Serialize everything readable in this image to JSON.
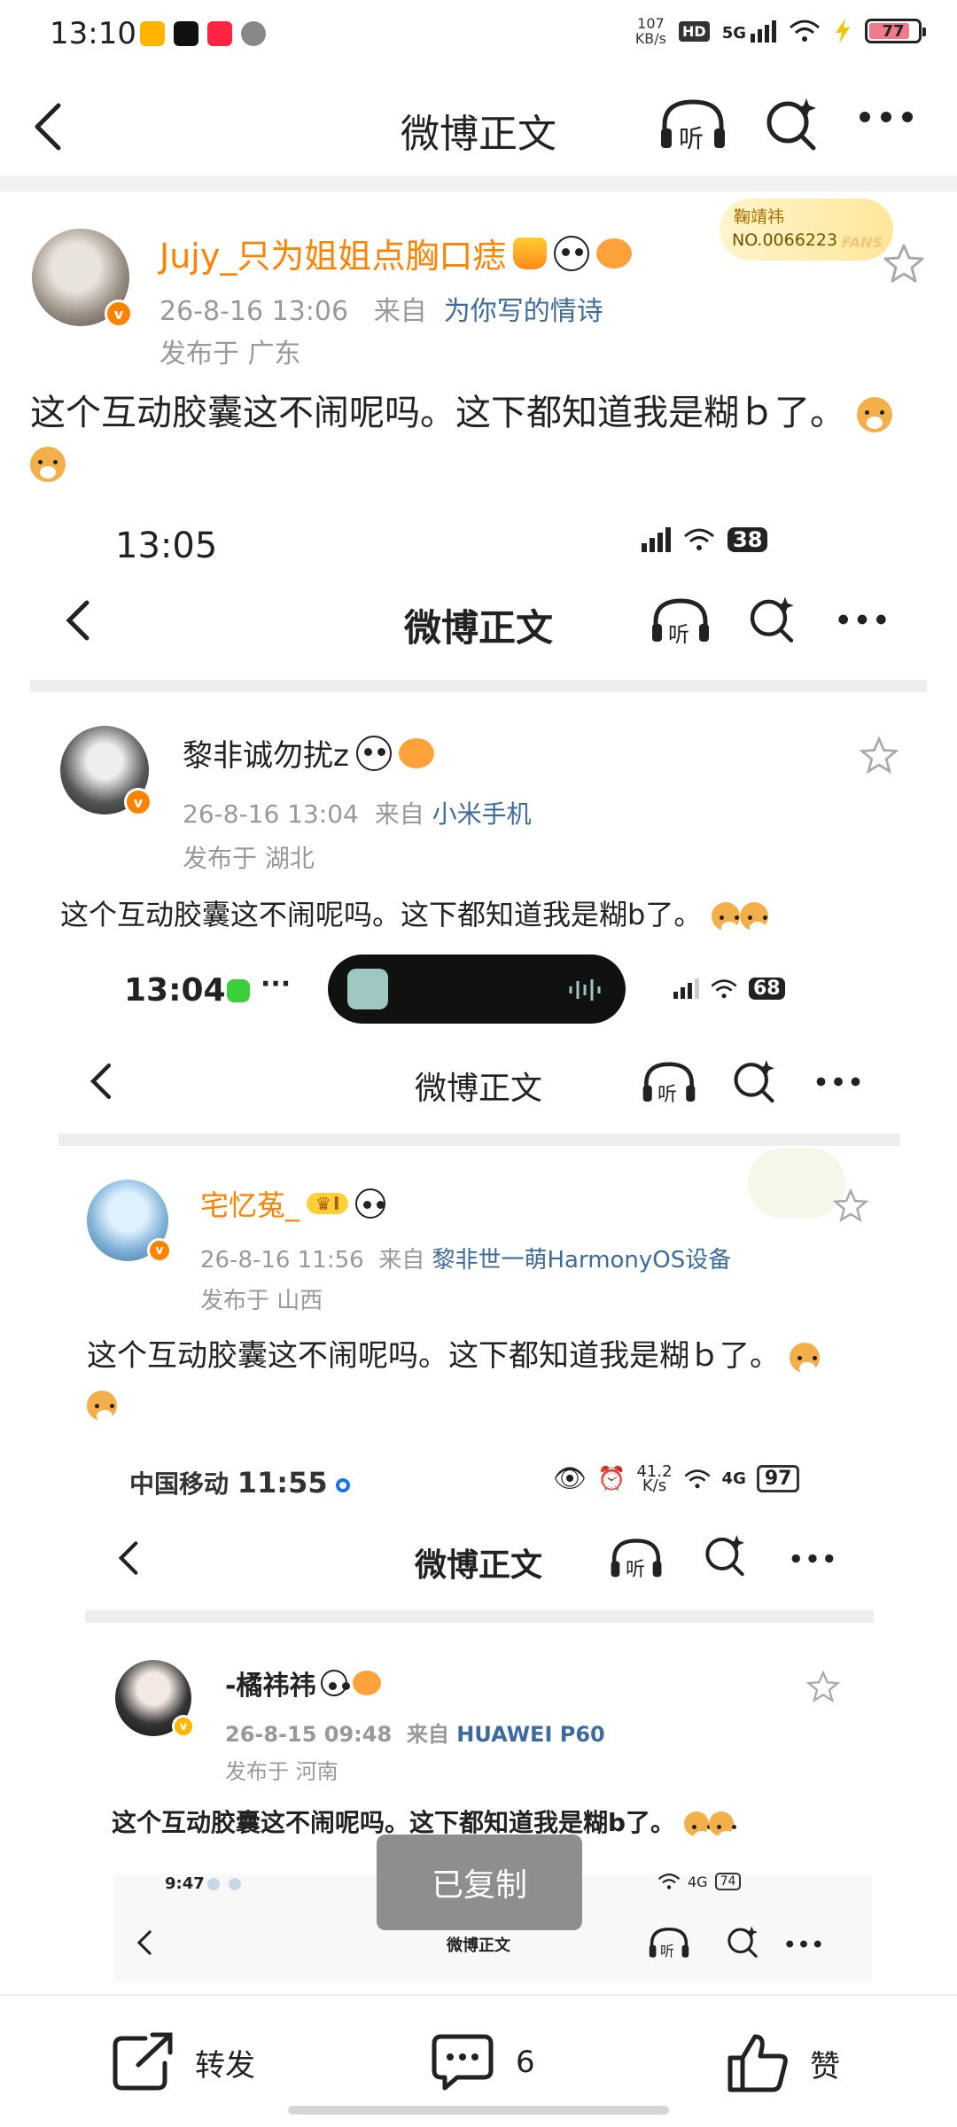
{
  "status_bar": {
    "time": "13:10",
    "speed_value": "107",
    "speed_unit": "KB/s",
    "hd_label": "HD",
    "network_label": "5G",
    "battery_level": "77"
  },
  "nav": {
    "title": "微博正文",
    "listen_label": "听"
  },
  "post": {
    "username": "Jujy_只为姐姐点胸口痣",
    "date": "26-8-16 13:06",
    "from_prefix": "来自",
    "source": "为你写的情诗",
    "location": "发布于 广东",
    "fan_badge_name": "鞠靖祎",
    "fan_badge_number": "NO.0066223",
    "fan_badge_sub": "FANS",
    "content": "这个互动胶囊这不闹呢吗。这下都知道我是糊ｂ了。"
  },
  "nested": [
    {
      "time": "13:05",
      "battery": "38",
      "nav_title": "微博正文",
      "listen_label": "听",
      "username": "黎非诚勿扰z",
      "date": "26-8-16 13:04",
      "from_prefix": "来自",
      "source": "小米手机",
      "location": "发布于 湖北",
      "content": "这个互动胶囊这不闹呢吗。这下都知道我是糊b了。"
    },
    {
      "time": "13:04",
      "battery": "68",
      "nav_title": "微博正文",
      "listen_label": "听",
      "username": "宅忆菟_",
      "level_badge": "I",
      "date": "26-8-16 11:56",
      "from_prefix": "来自",
      "source": "黎非世一萌HarmonyOS设备",
      "location": "发布于 山西",
      "content": "这个互动胶囊这不闹呢吗。这下都知道我是糊ｂ了。"
    },
    {
      "carrier": "中国移动",
      "time": "11:55",
      "speed_value": "41.2",
      "speed_unit": "K/s",
      "network_label": "4G",
      "battery": "97",
      "nav_title": "微博正文",
      "listen_label": "听",
      "username": "-橘祎祎",
      "date": "26-8-15 09:48",
      "from_prefix": "来自",
      "source": "HUAWEI P60",
      "location": "发布于 河南",
      "content": "这个互动胶囊这不闹呢吗。这下都知道我是糊b了。"
    },
    {
      "time": "9:47",
      "network_label": "4G",
      "battery": "74",
      "nav_title": "微博正文",
      "listen_label": "听"
    }
  ],
  "toast": "已复制",
  "toolbar": {
    "repost_label": "转发",
    "comment_count": "6",
    "like_label": "赞"
  },
  "colors": {
    "username_orange": "#ff8200",
    "source_blue": "#3d6b9e",
    "meta_gray": "#999999"
  }
}
